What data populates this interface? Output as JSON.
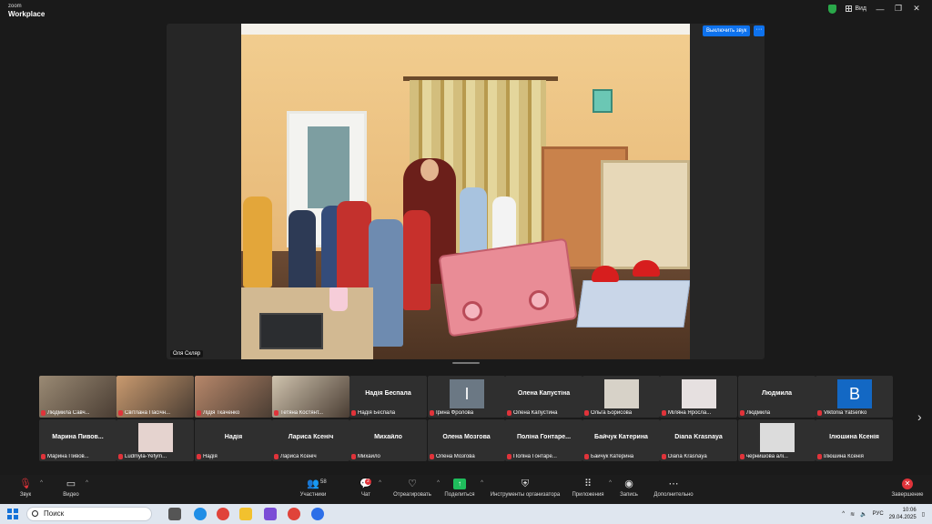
{
  "app": {
    "logo_line1": "zoom",
    "logo_line2": "Workplace"
  },
  "topbar": {
    "view_label": "Вид",
    "minimize": "—",
    "maximize": "❐",
    "close": "✕"
  },
  "main_video": {
    "participant_name": "Оля Скляр",
    "unmute_button": "Выключить звук",
    "more_button": "···"
  },
  "gallery": {
    "row1": [
      {
        "type": "video",
        "name": "Людмила Савч...",
        "photo_color": "#9a8a74"
      },
      {
        "type": "video",
        "name": "Світлана Пасічн...",
        "photo_color": "#c99a6f"
      },
      {
        "type": "video",
        "name": "Лідія Ткаченко",
        "photo_color": "#b7876a"
      },
      {
        "type": "video",
        "name": "Тетяна Костянт...",
        "photo_color": "#cfc3ae"
      },
      {
        "type": "name",
        "center": "Надія Беспала",
        "name": "Надія Беспала"
      },
      {
        "type": "letter",
        "letter": "І",
        "name": "Ірина Фролова",
        "avatar_color": "#6b7884"
      },
      {
        "type": "name",
        "center": "Олена Капустіна",
        "name": "Олена Капустина"
      },
      {
        "type": "photo",
        "name": "Ольга Борисова",
        "avatar_color": "#d7d2c8"
      },
      {
        "type": "photo",
        "name": "Міляна Яросла...",
        "avatar_color": "#e6e0e0"
      },
      {
        "type": "name",
        "center": "Людмила",
        "name": "Людмила"
      },
      {
        "type": "letter",
        "letter": "B",
        "name": "Viktoriia Yatsenko",
        "avatar_color": "#1368c4"
      }
    ],
    "row2": [
      {
        "type": "name",
        "center": "Марина  Пивов...",
        "name": "Марина Пивов..."
      },
      {
        "type": "photo",
        "name": "Ludmyla-Yefym...",
        "avatar_color": "#e5d3cf"
      },
      {
        "type": "name",
        "center": "Надія",
        "name": "Надія"
      },
      {
        "type": "name",
        "center": "Лариса Ксеніч",
        "name": "Лариса Ксеніч"
      },
      {
        "type": "name",
        "center": "Михайло",
        "name": "Михайло"
      },
      {
        "type": "name",
        "center": "Олена Мозгова",
        "name": "Олена Мозгова"
      },
      {
        "type": "name",
        "center": "Поліна Гонтаре...",
        "name": "Поліна Гонтаре..."
      },
      {
        "type": "name",
        "center": "Байчук Катерина",
        "name": "Байчук Катерина"
      },
      {
        "type": "name",
        "center": "Diana Krasnaya",
        "name": "Diana Krasnaya"
      },
      {
        "type": "photo",
        "name": "чернишова алі...",
        "avatar_color": "#dcdcdc"
      },
      {
        "type": "name",
        "center": "Ілюшина Ксенія",
        "name": "Ілюшина Ксенія"
      }
    ]
  },
  "toolbar": {
    "audio": "Звук",
    "video": "Видео",
    "participants": "Участники",
    "participants_count": "58",
    "chat": "Чат",
    "chat_badge": "2",
    "react": "Отреагировать",
    "share": "Поделиться",
    "host_tools": "Инструменты организатора",
    "apps": "Приложения",
    "record": "Запись",
    "more": "Дополнительно",
    "end": "Завершение"
  },
  "taskbar": {
    "search_placeholder": "Поиск",
    "language": "РУС",
    "time": "10:06",
    "date": "29.04.2025"
  },
  "colors": {
    "accent": "#0e72ed",
    "danger": "#e0333a",
    "share": "#1fbd5c"
  }
}
